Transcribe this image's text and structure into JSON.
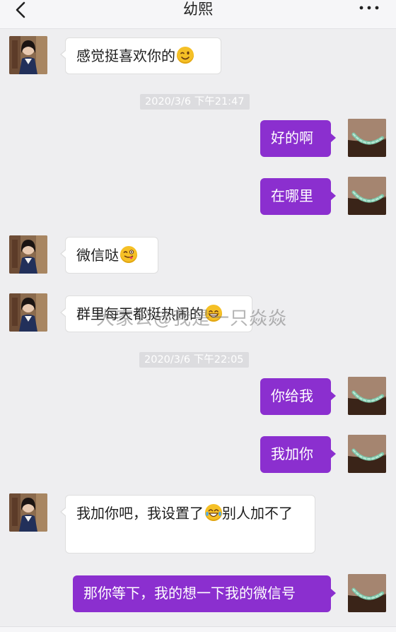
{
  "header": {
    "title": "幼熙"
  },
  "messages": {
    "m1": {
      "text": "感觉挺喜欢你的",
      "emoji": "wink-emoji"
    },
    "t1": "2020/3/6 下午21:47",
    "m2": {
      "text": "好的啊"
    },
    "m3": {
      "text": "在哪里"
    },
    "m4": {
      "text": "微信哒",
      "emoji": "tongue-wink-emoji"
    },
    "m5": {
      "text": "群里每天都挺热闹的",
      "emoji": "grin-emoji"
    },
    "t2": "2020/3/6 下午22:05",
    "m6": {
      "text": "你给我"
    },
    "m7": {
      "text": "我加你"
    },
    "m8": {
      "text_before": "我加你吧，我设置了",
      "emoji": "tears-of-joy-emoji",
      "text_after": "别人加不了"
    },
    "m9": {
      "text": "那你等下，我的想一下我的微信号"
    }
  },
  "watermark": "大家公@我是一只焱焱",
  "colors": {
    "outgoing_bubble": "#8b2fcf",
    "incoming_bubble": "#ffffff",
    "background": "#eeeef0",
    "timestamp_bg": "#dcdcdf"
  }
}
